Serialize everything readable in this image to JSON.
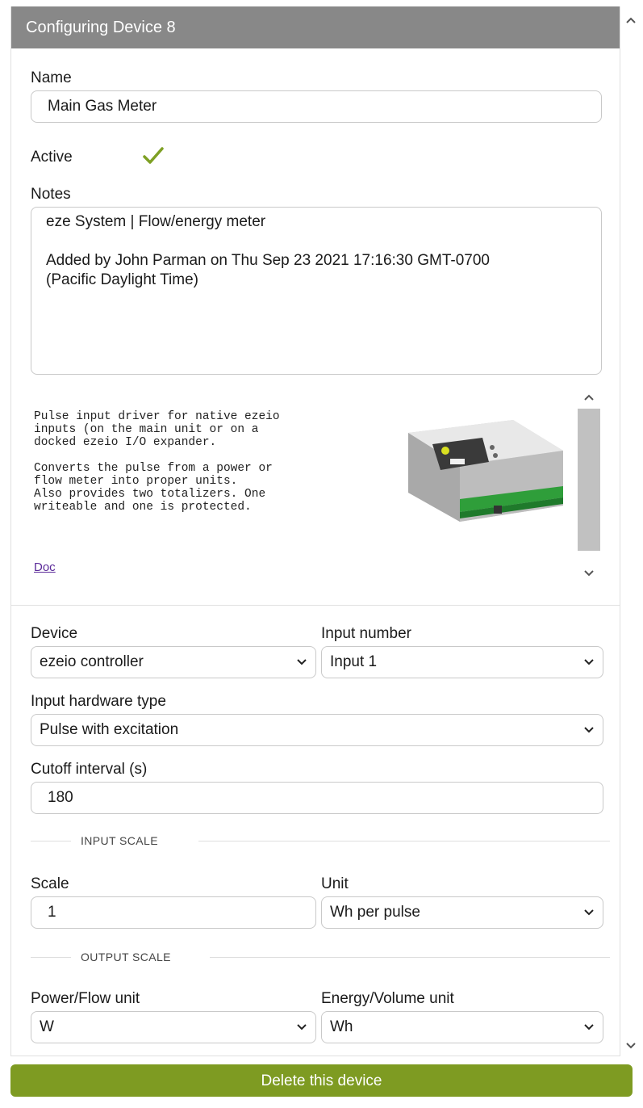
{
  "header": {
    "title": "Configuring Device 8"
  },
  "name": {
    "label": "Name",
    "value": "Main Gas Meter"
  },
  "active": {
    "label": "Active",
    "checked": true
  },
  "notes": {
    "label": "Notes",
    "value": "eze System | Flow/energy meter\n\nAdded by John Parman on Thu Sep 23 2021 17:16:30 GMT-0700\n(Pacific Daylight Time)"
  },
  "driver_doc": {
    "text": "Pulse input driver for native ezeio\ninputs (on the main unit or on a\ndocked ezeio I/O expander.\n\nConverts the pulse from a power or\nflow meter into proper units.\nAlso provides two totalizers. One\nwriteable and one is protected.",
    "link": "Doc"
  },
  "device": {
    "label": "Device",
    "value": "ezeio controller"
  },
  "input_number": {
    "label": "Input number",
    "value": "Input 1"
  },
  "input_hw_type": {
    "label": "Input hardware type",
    "value": "Pulse with excitation"
  },
  "cutoff": {
    "label": "Cutoff interval (s)",
    "value": "180"
  },
  "input_scale": {
    "title": "INPUT SCALE",
    "scale_label": "Scale",
    "scale_value": "1",
    "unit_label": "Unit",
    "unit_value": "Wh per pulse"
  },
  "output_scale": {
    "title": "OUTPUT SCALE",
    "power_label": "Power/Flow unit",
    "power_value": "W",
    "energy_label": "Energy/Volume unit",
    "energy_value": "Wh"
  },
  "delete_label": "Delete this device",
  "icons": {
    "checkmark": "check-icon",
    "chevron": "chevron-down-icon",
    "scroll_up": "chevron-up-icon",
    "scroll_down": "chevron-down-icon"
  },
  "colors": {
    "header_bg": "#888888",
    "delete_bg": "#7e9b22",
    "checkmark": "#7ea024",
    "link": "#5b2a99"
  }
}
